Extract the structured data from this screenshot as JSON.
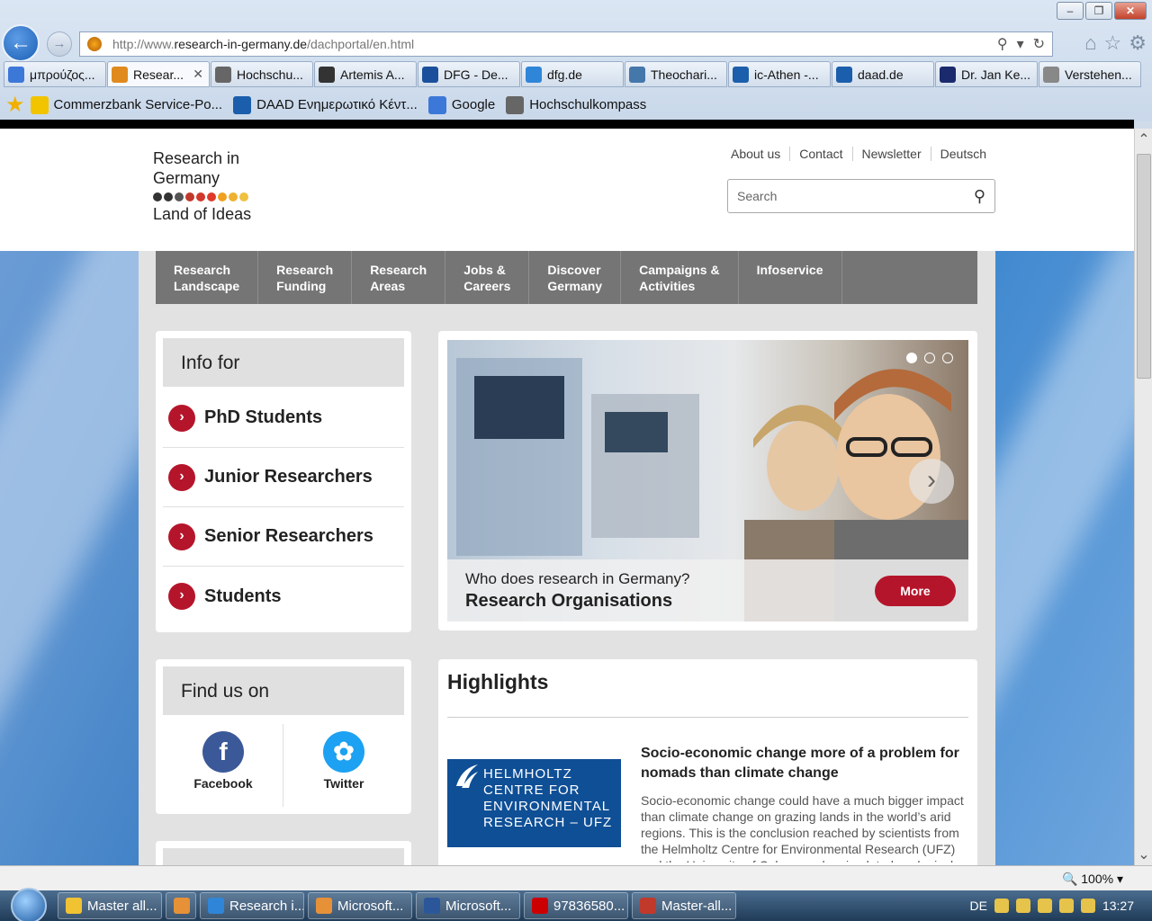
{
  "window": {
    "minimize": "–",
    "restore": "❐",
    "close": "✕"
  },
  "address": {
    "url_prefix": "http://www.",
    "url_domain": "research-in-germany.de",
    "url_path": "/dachportal/en.html"
  },
  "tabs": [
    {
      "label": "μπρούζος...",
      "icon": "google-icon",
      "color": "#3c78d8"
    },
    {
      "label": "Resear...",
      "icon": "research-in-germany-icon",
      "color": "#e08a1e",
      "active": true
    },
    {
      "label": "Hochschu...",
      "icon": "hochschulkompass-icon",
      "color": "#666666"
    },
    {
      "label": "Artemis A...",
      "icon": "wikipedia-icon",
      "color": "#333333"
    },
    {
      "label": "DFG - De...",
      "icon": "dfg-icon",
      "color": "#1a4f9c"
    },
    {
      "label": "dfg.de",
      "icon": "ie-icon",
      "color": "#2f86d8"
    },
    {
      "label": "Theochari...",
      "icon": "page-icon",
      "color": "#4477aa"
    },
    {
      "label": "ic-Athen -...",
      "icon": "daad-icon",
      "color": "#1b5eab"
    },
    {
      "label": "daad.de",
      "icon": "daad-icon",
      "color": "#1b5eab"
    },
    {
      "label": "Dr. Jan Ke...",
      "icon": "flag-icon",
      "color": "#1a2a6c"
    },
    {
      "label": "Verstehen...",
      "icon": "doc-icon",
      "color": "#888888"
    }
  ],
  "favorites": [
    {
      "label": "Commerzbank Service-Po...",
      "icon": "commerzbank-icon",
      "color": "#f2c400"
    },
    {
      "label": "DAAD Ενημερωτικό Κέντ...",
      "icon": "daad-icon",
      "color": "#1b5eab"
    },
    {
      "label": "Google",
      "icon": "google-icon",
      "color": "#3c78d8"
    },
    {
      "label": "Hochschulkompass",
      "icon": "hochschulkompass-icon",
      "color": "#666666"
    }
  ],
  "site": {
    "logo": {
      "line1": "Research in",
      "line2": "Germany",
      "line3": "Land of Ideas"
    },
    "toplinks": [
      "About us",
      "Contact",
      "Newsletter",
      "Deutsch"
    ],
    "search_placeholder": "Search",
    "nav": [
      {
        "l1": "Research",
        "l2": "Landscape"
      },
      {
        "l1": "Research",
        "l2": "Funding"
      },
      {
        "l1": "Research",
        "l2": "Areas"
      },
      {
        "l1": "Jobs &",
        "l2": "Careers"
      },
      {
        "l1": "Discover",
        "l2": "Germany"
      },
      {
        "l1": "Campaigns &",
        "l2": "Activities"
      },
      {
        "l1": "Infoservice",
        "l2": ""
      }
    ],
    "info_for": {
      "title": "Info for",
      "items": [
        "PhD Students",
        "Junior Researchers",
        "Senior Researchers",
        "Students"
      ]
    },
    "slider": {
      "question": "Who does research in Germany?",
      "headline": "Research Organisations",
      "more": "More"
    },
    "find_us": {
      "title": "Find us on",
      "facebook": "Facebook",
      "twitter": "Twitter"
    },
    "highlights": {
      "title": "Highlights",
      "article_title": "Socio-economic change more of a problem for nomads than climate change",
      "article_text": "Socio-economic change could have a much bigger impact than climate change on grazing lands in the world’s arid regions. This is the conclusion reached by scientists from the Helmholtz Centre for Environmental Research (UFZ) and the University of Cologne, who simulated ecological",
      "logo_lines": [
        "HELMHOLTZ",
        "CENTRE FOR",
        "ENVIRONMENTAL",
        "RESEARCH – UFZ"
      ]
    }
  },
  "statusbar": {
    "zoom": "100%"
  },
  "taskbar": {
    "items": [
      {
        "label": "Master all...",
        "color": "#f1c232"
      },
      {
        "label": "",
        "color": "#e69138"
      },
      {
        "label": "Research i...",
        "color": "#2f86d8"
      },
      {
        "label": "Microsoft...",
        "color": "#e69138"
      },
      {
        "label": "Microsoft...",
        "color": "#2b579a"
      },
      {
        "label": "97836580...",
        "color": "#cc0000"
      },
      {
        "label": "Master-all...",
        "color": "#c0392b"
      }
    ],
    "lang": "DE",
    "clock": "13:27"
  }
}
